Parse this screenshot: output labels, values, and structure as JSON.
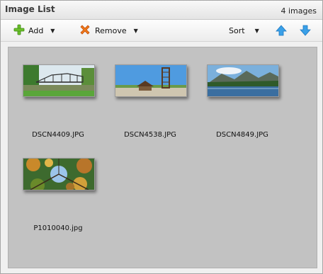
{
  "header": {
    "title": "Image List",
    "count": "4 images"
  },
  "toolbar": {
    "add_label": "Add",
    "remove_label": "Remove",
    "sort_label": "Sort"
  },
  "icons": {
    "add": "plus-icon",
    "remove": "x-icon",
    "up": "arrow-up-icon",
    "down": "arrow-down-icon"
  },
  "colors": {
    "add_green": "#6cc02c",
    "remove_orange": "#f07a1a",
    "arrow_blue": "#3aa0e8",
    "content_bg": "#c2c2c2"
  },
  "images": [
    {
      "filename": "DSCN4409.JPG"
    },
    {
      "filename": "DSCN4538.JPG"
    },
    {
      "filename": "DSCN4849.JPG"
    },
    {
      "filename": "P1010040.jpg"
    }
  ]
}
